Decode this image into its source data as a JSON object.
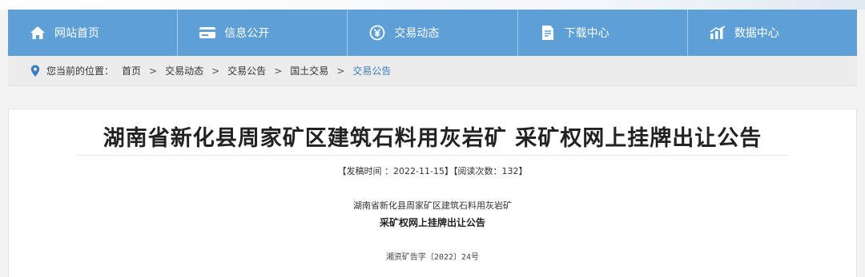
{
  "nav": {
    "items": [
      {
        "label": "网站首页",
        "icon": "home-icon"
      },
      {
        "label": "信息公开",
        "icon": "card-icon"
      },
      {
        "label": "交易动态",
        "icon": "yen-circle-icon"
      },
      {
        "label": "下载中心",
        "icon": "document-icon"
      },
      {
        "label": "数据中心",
        "icon": "bar-chart-icon"
      }
    ]
  },
  "breadcrumb": {
    "prefix": "您当前的位置：",
    "items": [
      "首页",
      "交易动态",
      "交易公告",
      "国土交易",
      "交易公告"
    ],
    "separator": ">"
  },
  "article": {
    "title": "湖南省新化县周家矿区建筑石料用灰岩矿 采矿权网上挂牌出让公告",
    "meta": "【发稿时间 ：2022-11-15】【阅读次数：132】",
    "subtitle_line1": "湖南省新化县周家矿区建筑石料用灰岩矿",
    "subtitle_line2": "采矿权网上挂牌出让公告",
    "doc_number": "湘资矿告字〔2022〕24号"
  },
  "colors": {
    "nav_bg": "#5e9fd6",
    "link_current": "#3a7ec0",
    "pin": "#3a7ec0"
  }
}
